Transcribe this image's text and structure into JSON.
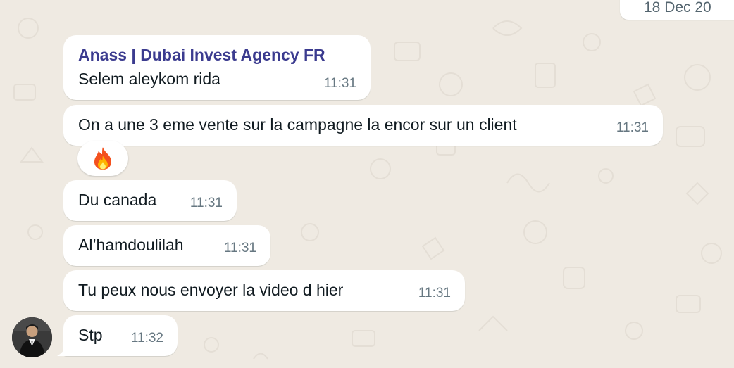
{
  "date_separator": "18 Dec 20",
  "messages": [
    {
      "sender": "Anass | Dubai Invest Agency FR",
      "text": "Selem aleykom rida",
      "time": "11:31"
    },
    {
      "text": "On a une 3 eme vente sur la campagne la encor sur un client",
      "time": "11:31",
      "reaction": "fire-emoji"
    },
    {
      "text": "Du canada",
      "time": "11:31"
    },
    {
      "text": "Al’hamdoulilah",
      "time": "11:31"
    },
    {
      "text": "Tu peux nous envoyer la video d hier",
      "time": "11:31"
    },
    {
      "text": "Stp",
      "time": "11:32"
    }
  ],
  "colors": {
    "background": "#efeae2",
    "bubble": "#ffffff",
    "sender_name": "#3b3b8f",
    "timestamp": "#667781"
  }
}
